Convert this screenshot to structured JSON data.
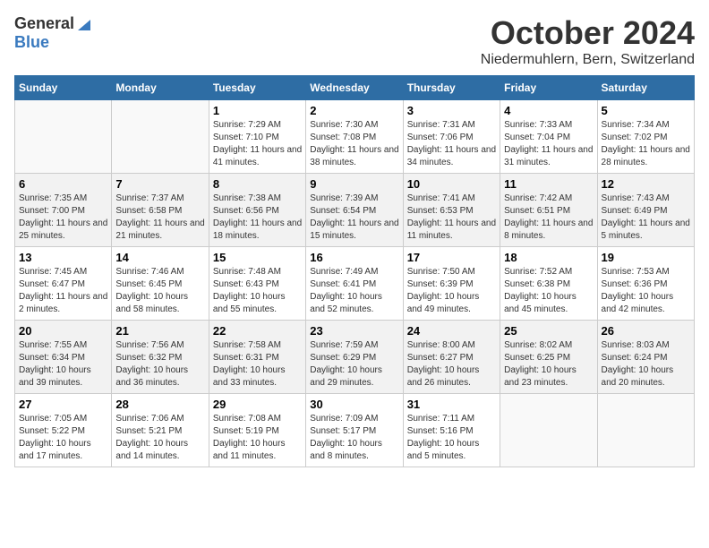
{
  "header": {
    "logo_general": "General",
    "logo_blue": "Blue",
    "month_title": "October 2024",
    "location": "Niedermuhlern, Bern, Switzerland"
  },
  "days_of_week": [
    "Sunday",
    "Monday",
    "Tuesday",
    "Wednesday",
    "Thursday",
    "Friday",
    "Saturday"
  ],
  "weeks": [
    [
      {
        "day": "",
        "empty": true
      },
      {
        "day": "",
        "empty": true
      },
      {
        "day": "1",
        "sunrise": "Sunrise: 7:29 AM",
        "sunset": "Sunset: 7:10 PM",
        "daylight": "Daylight: 11 hours and 41 minutes."
      },
      {
        "day": "2",
        "sunrise": "Sunrise: 7:30 AM",
        "sunset": "Sunset: 7:08 PM",
        "daylight": "Daylight: 11 hours and 38 minutes."
      },
      {
        "day": "3",
        "sunrise": "Sunrise: 7:31 AM",
        "sunset": "Sunset: 7:06 PM",
        "daylight": "Daylight: 11 hours and 34 minutes."
      },
      {
        "day": "4",
        "sunrise": "Sunrise: 7:33 AM",
        "sunset": "Sunset: 7:04 PM",
        "daylight": "Daylight: 11 hours and 31 minutes."
      },
      {
        "day": "5",
        "sunrise": "Sunrise: 7:34 AM",
        "sunset": "Sunset: 7:02 PM",
        "daylight": "Daylight: 11 hours and 28 minutes."
      }
    ],
    [
      {
        "day": "6",
        "sunrise": "Sunrise: 7:35 AM",
        "sunset": "Sunset: 7:00 PM",
        "daylight": "Daylight: 11 hours and 25 minutes."
      },
      {
        "day": "7",
        "sunrise": "Sunrise: 7:37 AM",
        "sunset": "Sunset: 6:58 PM",
        "daylight": "Daylight: 11 hours and 21 minutes."
      },
      {
        "day": "8",
        "sunrise": "Sunrise: 7:38 AM",
        "sunset": "Sunset: 6:56 PM",
        "daylight": "Daylight: 11 hours and 18 minutes."
      },
      {
        "day": "9",
        "sunrise": "Sunrise: 7:39 AM",
        "sunset": "Sunset: 6:54 PM",
        "daylight": "Daylight: 11 hours and 15 minutes."
      },
      {
        "day": "10",
        "sunrise": "Sunrise: 7:41 AM",
        "sunset": "Sunset: 6:53 PM",
        "daylight": "Daylight: 11 hours and 11 minutes."
      },
      {
        "day": "11",
        "sunrise": "Sunrise: 7:42 AM",
        "sunset": "Sunset: 6:51 PM",
        "daylight": "Daylight: 11 hours and 8 minutes."
      },
      {
        "day": "12",
        "sunrise": "Sunrise: 7:43 AM",
        "sunset": "Sunset: 6:49 PM",
        "daylight": "Daylight: 11 hours and 5 minutes."
      }
    ],
    [
      {
        "day": "13",
        "sunrise": "Sunrise: 7:45 AM",
        "sunset": "Sunset: 6:47 PM",
        "daylight": "Daylight: 11 hours and 2 minutes."
      },
      {
        "day": "14",
        "sunrise": "Sunrise: 7:46 AM",
        "sunset": "Sunset: 6:45 PM",
        "daylight": "Daylight: 10 hours and 58 minutes."
      },
      {
        "day": "15",
        "sunrise": "Sunrise: 7:48 AM",
        "sunset": "Sunset: 6:43 PM",
        "daylight": "Daylight: 10 hours and 55 minutes."
      },
      {
        "day": "16",
        "sunrise": "Sunrise: 7:49 AM",
        "sunset": "Sunset: 6:41 PM",
        "daylight": "Daylight: 10 hours and 52 minutes."
      },
      {
        "day": "17",
        "sunrise": "Sunrise: 7:50 AM",
        "sunset": "Sunset: 6:39 PM",
        "daylight": "Daylight: 10 hours and 49 minutes."
      },
      {
        "day": "18",
        "sunrise": "Sunrise: 7:52 AM",
        "sunset": "Sunset: 6:38 PM",
        "daylight": "Daylight: 10 hours and 45 minutes."
      },
      {
        "day": "19",
        "sunrise": "Sunrise: 7:53 AM",
        "sunset": "Sunset: 6:36 PM",
        "daylight": "Daylight: 10 hours and 42 minutes."
      }
    ],
    [
      {
        "day": "20",
        "sunrise": "Sunrise: 7:55 AM",
        "sunset": "Sunset: 6:34 PM",
        "daylight": "Daylight: 10 hours and 39 minutes."
      },
      {
        "day": "21",
        "sunrise": "Sunrise: 7:56 AM",
        "sunset": "Sunset: 6:32 PM",
        "daylight": "Daylight: 10 hours and 36 minutes."
      },
      {
        "day": "22",
        "sunrise": "Sunrise: 7:58 AM",
        "sunset": "Sunset: 6:31 PM",
        "daylight": "Daylight: 10 hours and 33 minutes."
      },
      {
        "day": "23",
        "sunrise": "Sunrise: 7:59 AM",
        "sunset": "Sunset: 6:29 PM",
        "daylight": "Daylight: 10 hours and 29 minutes."
      },
      {
        "day": "24",
        "sunrise": "Sunrise: 8:00 AM",
        "sunset": "Sunset: 6:27 PM",
        "daylight": "Daylight: 10 hours and 26 minutes."
      },
      {
        "day": "25",
        "sunrise": "Sunrise: 8:02 AM",
        "sunset": "Sunset: 6:25 PM",
        "daylight": "Daylight: 10 hours and 23 minutes."
      },
      {
        "day": "26",
        "sunrise": "Sunrise: 8:03 AM",
        "sunset": "Sunset: 6:24 PM",
        "daylight": "Daylight: 10 hours and 20 minutes."
      }
    ],
    [
      {
        "day": "27",
        "sunrise": "Sunrise: 7:05 AM",
        "sunset": "Sunset: 5:22 PM",
        "daylight": "Daylight: 10 hours and 17 minutes."
      },
      {
        "day": "28",
        "sunrise": "Sunrise: 7:06 AM",
        "sunset": "Sunset: 5:21 PM",
        "daylight": "Daylight: 10 hours and 14 minutes."
      },
      {
        "day": "29",
        "sunrise": "Sunrise: 7:08 AM",
        "sunset": "Sunset: 5:19 PM",
        "daylight": "Daylight: 10 hours and 11 minutes."
      },
      {
        "day": "30",
        "sunrise": "Sunrise: 7:09 AM",
        "sunset": "Sunset: 5:17 PM",
        "daylight": "Daylight: 10 hours and 8 minutes."
      },
      {
        "day": "31",
        "sunrise": "Sunrise: 7:11 AM",
        "sunset": "Sunset: 5:16 PM",
        "daylight": "Daylight: 10 hours and 5 minutes."
      },
      {
        "day": "",
        "empty": true
      },
      {
        "day": "",
        "empty": true
      }
    ]
  ]
}
